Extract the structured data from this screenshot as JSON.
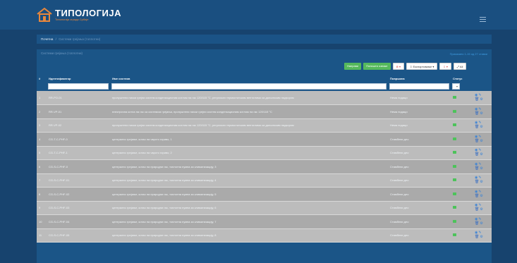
{
  "header": {
    "brand_title": "ТИПОЛОГИЈА",
    "brand_subtitle": "Типологија зграда Србије",
    "menu_icon": "hamburger-icon",
    "colors": {
      "accent": "#e8873c",
      "bar": "#1a4f80",
      "background": "#17436e"
    }
  },
  "breadcrumb": {
    "home": "Почетна",
    "separator": "/",
    "current": "Системи грејања (топлотни)"
  },
  "panel": {
    "title": "Системи грејања (топлотни)",
    "count": "Приказано 1-15 од 27 ставки"
  },
  "toolbar": {
    "new_label": "Направи",
    "reset_label": "Поништи ознаке",
    "delete_label": "⊗ ▾",
    "export_label": "⇩ Експортовање ▾",
    "options_label": "⇩ ▾",
    "all_label": "⤢ Ali"
  },
  "table": {
    "headers": {
      "idx": "#",
      "id": "Идентификатор",
      "name": "Име система",
      "area": "Површина",
      "status": "Статус"
    },
    "rows": [
      {
        "idx": "1",
        "id": "RR-PO-01",
        "name": "пропуштени ниски грејни систем кондензационим котлом на гас 120/115 °C, регулисан термостатским вентилима са даљинским надзором",
        "area": "Нема подаци"
      },
      {
        "idx": "2",
        "id": "RR-VP-01",
        "name": "електрична котла на гас са системом грејања, пропуштени ниски грејни систем кондензационим котлом на гас 120/115 °C",
        "area": "Нема подаци"
      },
      {
        "idx": "3",
        "id": "RR-VP-02",
        "name": "пропуштени ниски грејни систем кондензационим котлом на гас 120/115 °C, регулисан термостатским вентилима са даљинским надзором",
        "area": "Нема подаци"
      },
      {
        "idx": "4",
        "id": "CG-T-C-PHF-0",
        "name": "централно грејање, котао на чврсто гориво, 1",
        "area": "Стамбени део"
      },
      {
        "idx": "5",
        "id": "CG-T-C-PHF-1",
        "name": "централно грејање, котао на чврсто гориво, 2",
        "area": "Стамбени део"
      },
      {
        "idx": "6",
        "id": "CG-S-C-PHF-0",
        "name": "централно грејање, котао на природни гас, топлотна пумпа за климатизацију, 3",
        "area": "Стамбени део"
      },
      {
        "idx": "7",
        "id": "CG-S-C-PHF-01",
        "name": "централно грејање, котао на природни гас, топлотна пумпа за климатизацију, 4",
        "area": "Стамбени део"
      },
      {
        "idx": "8",
        "id": "CG-S-C-PHF-02",
        "name": "централно грејање, котао на природни гас, топлотна пумпа за климатизацију, 5",
        "area": "Стамбени део"
      },
      {
        "idx": "9",
        "id": "CG-S-C-PHF-03",
        "name": "централно грејање, котао на природни гас, топлотна пумпа за климатизацију, 6",
        "area": "Стамбени део"
      },
      {
        "idx": "10",
        "id": "CG-S-C-PHF-04",
        "name": "централно грејање, котао на природни гас, топлотна пумпа за климатизацију, 7",
        "area": "Стамбени део"
      },
      {
        "idx": "11",
        "id": "CG-S-C-PHF-05",
        "name": "централно грејање, котао на природни гас, топлотна пумпа за климатизацију, 8",
        "area": "Стамбени део"
      }
    ],
    "actions_icons": [
      "view-icon",
      "edit-icon",
      "delete-icon",
      "settings-icon"
    ]
  }
}
